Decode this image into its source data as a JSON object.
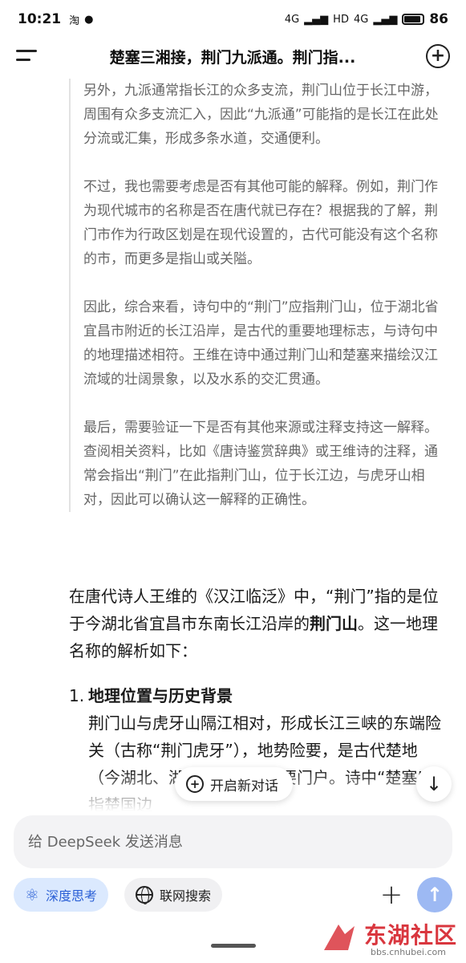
{
  "status_bar": {
    "time": "10:21",
    "app_icon_1": "淘",
    "network_text": "4G",
    "hd_text": "HD",
    "battery_pct": "86"
  },
  "header": {
    "title": "楚塞三湘接，荆门九派通。荆门指...",
    "menu_icon": "menu-icon",
    "new_chat_icon": "plus-circle-icon"
  },
  "thinking": {
    "paragraphs": [
      "另外，九派通常指长江的众多支流，荆门山位于长江中游，周围有众多支流汇入，因此“九派通”可能指的是长江在此处分流或汇集，形成多条水道，交通便利。",
      "不过，我也需要考虑是否有其他可能的解释。例如，荆门作为现代城市的名称是否在唐代就已存在？根据我的了解，荆门市作为行政区划是在现代设置的，古代可能没有这个名称的市，而更多是指山或关隘。",
      "因此，综合来看，诗句中的“荆门”应指荆门山，位于湖北省宜昌市附近的长江沿岸，是古代的重要地理标志，与诗句中的地理描述相符。王维在诗中通过荆门山和楚塞来描绘汉江流域的壮阔景象，以及水系的交汇贯通。",
      "最后，需要验证一下是否有其他来源或注释支持这一解释。查阅相关资料，比如《唐诗鉴赏辞典》或王维诗的注释，通常会指出“荆门”在此指荆门山，位于长江边，与虎牙山相对，因此可以确认这一解释的正确性。"
    ]
  },
  "answer": {
    "intro_before": "在唐代诗人王维的《汉江临泛》中，“荆门”指的是位于今湖北省宜昌市东南长江沿岸的",
    "intro_bold": "荆门山",
    "intro_after": "。这一地理名称的解析如下：",
    "section_number": "1.",
    "section_heading": "地理位置与历史背景",
    "section_body": "荆门山与虎牙山隔江相对，形成长江三峡的东端险关（古称“荆门虎牙”），地势险要，是古代楚地（今湖北、湖南一带）的重要门户。诗中“楚塞”即指楚国边"
  },
  "floating": {
    "new_chat_label": "开启新对话",
    "scroll_down_icon": "arrow-down-icon"
  },
  "input": {
    "placeholder": "给 DeepSeek 发送消息"
  },
  "toolbar": {
    "deep_think_label": "深度思考",
    "web_search_label": "联网搜索",
    "accent_color": "#2a5fd6",
    "send_color": "#9db9f3"
  },
  "watermark": {
    "brand": "东湖社区",
    "url": "bbs.cnhubei.com"
  }
}
